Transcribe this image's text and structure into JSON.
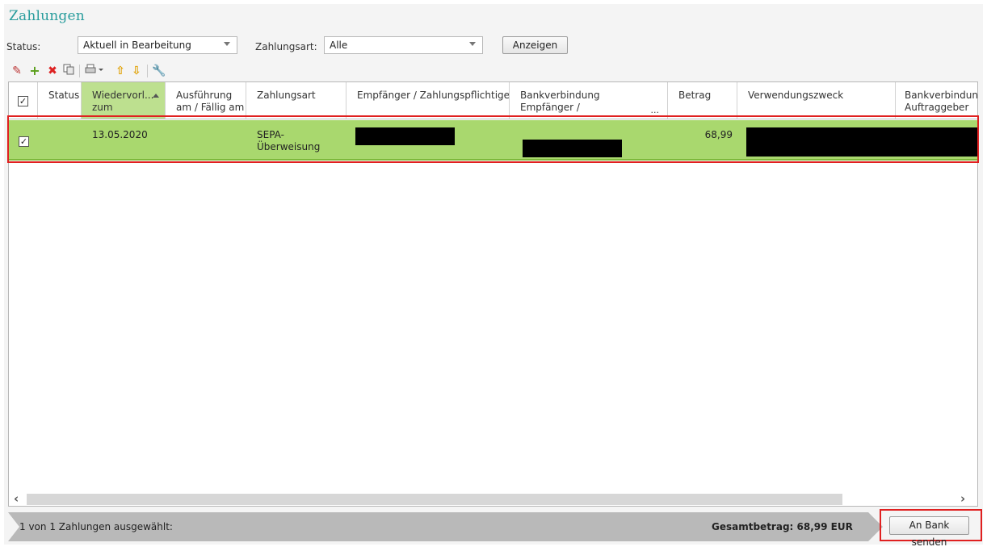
{
  "page": {
    "title": "Zahlungen"
  },
  "filters": {
    "status_label": "Status:",
    "status_value": "Aktuell in Bearbeitung",
    "zahlungsart_label": "Zahlungsart:",
    "zahlungsart_value": "Alle",
    "show_button": "Anzeigen"
  },
  "toolbar": {
    "edit_icon": "pencil-icon",
    "add_icon": "plus-icon",
    "delete_icon": "x-icon",
    "copy_icon": "copy-icon",
    "print_icon": "print-icon",
    "up_icon": "arrow-up-icon",
    "down_icon": "arrow-down-icon",
    "settings_icon": "wrench-icon"
  },
  "table": {
    "columns": [
      {
        "line1": "",
        "line2": ""
      },
      {
        "line1": "Status",
        "line2": ""
      },
      {
        "line1": "Wiedervorl...",
        "line2": "zum"
      },
      {
        "line1": "Ausführung",
        "line2": "am / Fällig am"
      },
      {
        "line1": "Zahlungsart",
        "line2": ""
      },
      {
        "line1": "Empfänger / Zahlungspflichtiger",
        "line2": ""
      },
      {
        "line1": "Bankverbindung",
        "line2": "Empfänger /"
      },
      {
        "line1": "Betrag",
        "line2": ""
      },
      {
        "line1": "Verwendungszweck",
        "line2": ""
      },
      {
        "line1": "Bankverbindung",
        "line2": "Auftraggeber"
      }
    ],
    "header_ellipsis": "...",
    "rows": [
      {
        "selected": true,
        "status": "",
        "wiedervorlage": "13.05.2020",
        "ausfuehrung": "",
        "zahlungsart_line1": "SEPA-",
        "zahlungsart_line2": "Überweisung",
        "betrag": "68,99"
      }
    ]
  },
  "statusbar": {
    "selection_text": "1 von 1 Zahlungen ausgewählt:",
    "total_text": "Gesamtbetrag: 68,99 EUR",
    "send_button": "An Bank senden"
  },
  "colors": {
    "title": "#2a9d9d",
    "selected_row": "#a9d86e",
    "sorted_header": "#bde08f",
    "highlight_frame": "#e02020",
    "statusbar": "#b9b9b9"
  }
}
